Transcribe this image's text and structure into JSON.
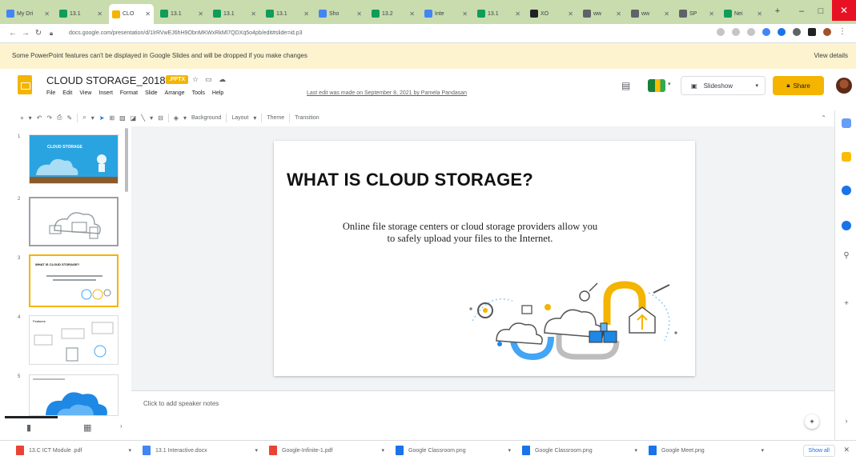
{
  "browser": {
    "tabs": [
      {
        "label": "My Dri",
        "color": "#4285f4"
      },
      {
        "label": "13.1",
        "color": "#0f9d58"
      },
      {
        "label": "CLO",
        "color": "#f4b400"
      },
      {
        "label": "13.1",
        "color": "#0f9d58"
      },
      {
        "label": "13.1",
        "color": "#0f9d58"
      },
      {
        "label": "13.1",
        "color": "#0f9d58"
      },
      {
        "label": "Sho",
        "color": "#4285f4"
      },
      {
        "label": "13.2",
        "color": "#0f9d58"
      },
      {
        "label": "Inte",
        "color": "#4285f4"
      },
      {
        "label": "13.1",
        "color": "#0f9d58"
      },
      {
        "label": "XO",
        "color": "#202124"
      },
      {
        "label": "ww",
        "color": "#5f6368"
      },
      {
        "label": "ww",
        "color": "#5f6368"
      },
      {
        "label": "SP",
        "color": "#5f6368"
      },
      {
        "label": "Nei",
        "color": "#0f9d58"
      }
    ],
    "new_tab": "+",
    "minimize": "–",
    "maximize": "□",
    "close": "✕",
    "url": "docs.google.com/presentation/d/1lrRVwEJ6hH9ObnMKWxRkMl7QDXq5o4pb/edit#slide=id.p3"
  },
  "banner": {
    "text": "Some PowerPoint features can't be displayed in Google Slides and will be dropped if you make changes",
    "link": "View details"
  },
  "header": {
    "title": "CLOUD STORAGE_2018",
    "badge": ".PPTX",
    "menu": [
      "File",
      "Edit",
      "View",
      "Insert",
      "Format",
      "Slide",
      "Arrange",
      "Tools",
      "Help"
    ],
    "last_edit": "Last edit was made on September 8, 2021 by Pamela Pandasan",
    "slideshow_label": "Slideshow",
    "share_label": "Share"
  },
  "toolbar": {
    "background": "Background",
    "layout": "Layout",
    "theme": "Theme",
    "transition": "Transition"
  },
  "filmstrip": {
    "slides": [
      {
        "num": "1",
        "caption": "CLOUD STORAGE"
      },
      {
        "num": "2",
        "caption": ""
      },
      {
        "num": "3",
        "caption": "WHAT IS CLOUD STORAGE?"
      },
      {
        "num": "4",
        "caption": "Features"
      },
      {
        "num": "5",
        "caption": ""
      }
    ]
  },
  "slide": {
    "title": "WHAT IS CLOUD STORAGE?",
    "body": "Online file storage centers or cloud storage providers allow you to safely upload your files to the Internet."
  },
  "notes": {
    "placeholder": "Click to add speaker notes"
  },
  "downloads": {
    "items": [
      {
        "name": "13.C ICT Module .pdf",
        "color": "#ea4335"
      },
      {
        "name": "13.1 Interactive.docx",
        "color": "#4285f4"
      },
      {
        "name": "Google-Infinite-1.pdf",
        "color": "#ea4335"
      },
      {
        "name": "Google Classroom.png",
        "color": "#1a73e8"
      },
      {
        "name": "Google Classroom.png",
        "color": "#1a73e8"
      },
      {
        "name": "Google Meet.png",
        "color": "#1a73e8"
      }
    ],
    "show_all": "Show all"
  }
}
